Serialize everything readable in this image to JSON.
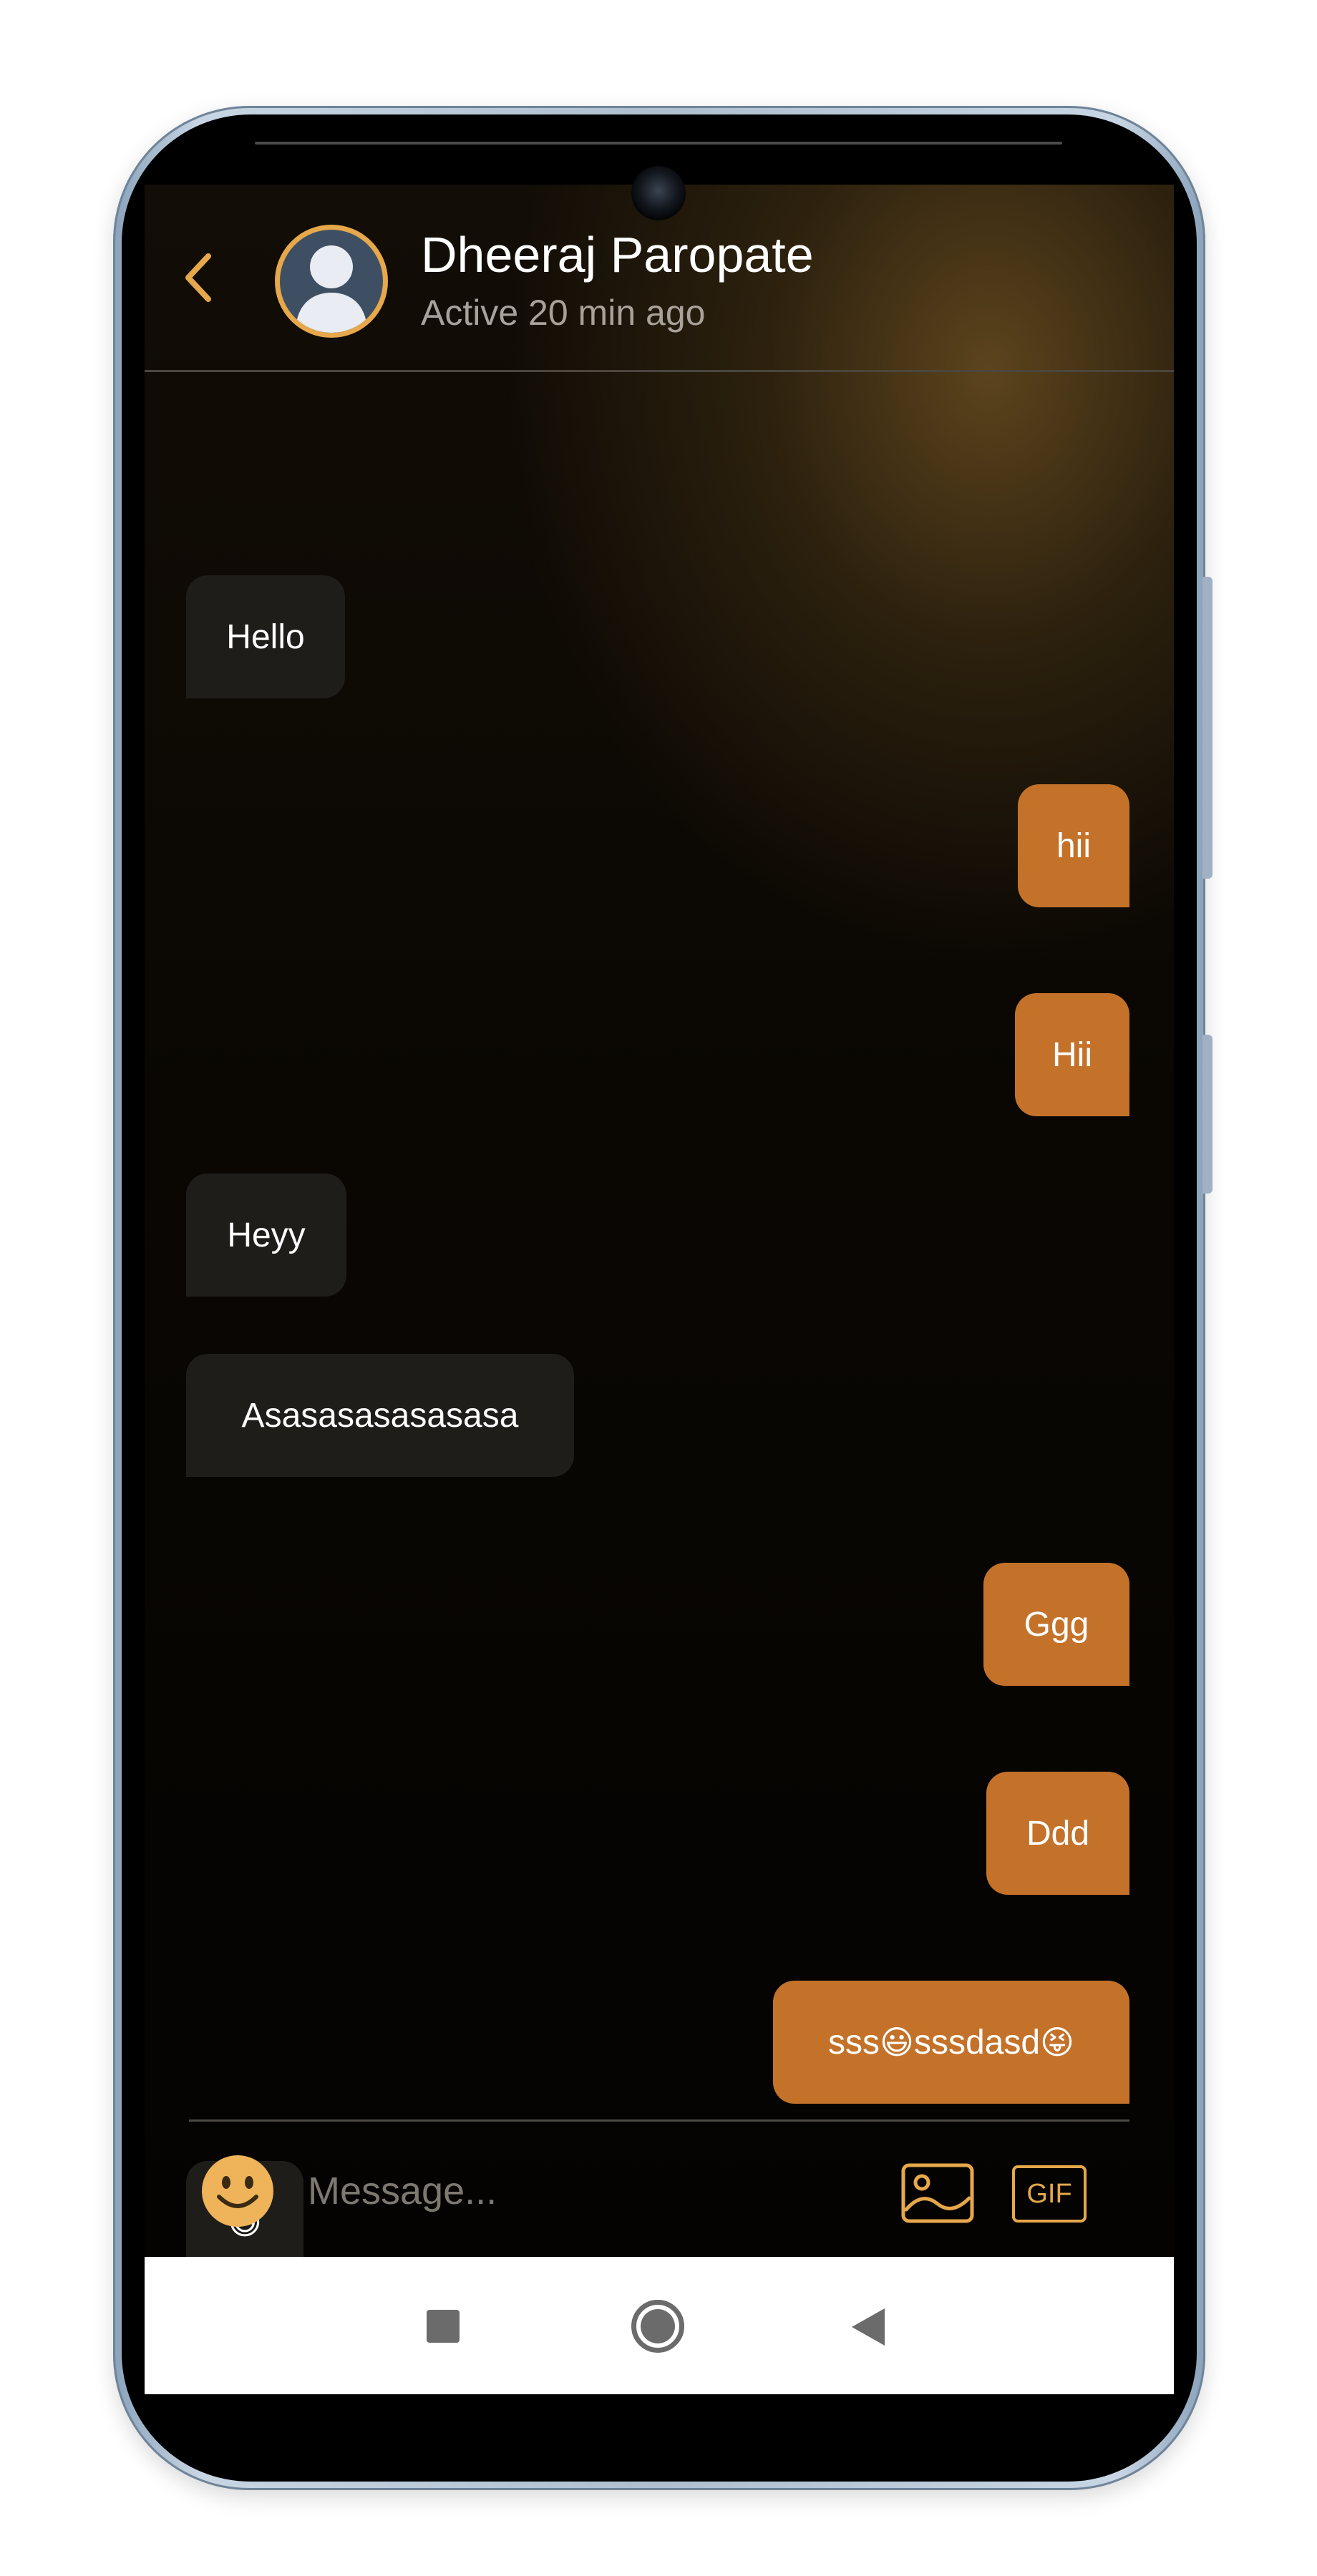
{
  "header": {
    "back_icon": "chevron-left-icon",
    "avatar_icon": "default-user-avatar",
    "contact_name": "Dheeraj Paropate",
    "status": "Active 20 min ago"
  },
  "messages": [
    {
      "direction": "in",
      "text": "Hello"
    },
    {
      "direction": "out",
      "text": "hii"
    },
    {
      "direction": "out",
      "text": "Hii"
    },
    {
      "direction": "in",
      "text": "Heyy"
    },
    {
      "direction": "in",
      "text": "Asasasasasasasa"
    },
    {
      "direction": "out",
      "text": "Ggg"
    },
    {
      "direction": "out",
      "text": "Ddd"
    },
    {
      "direction": "out",
      "text_before": "sss",
      "emoji_1": "😃",
      "text_middle": "sssdasd",
      "emoji_2": "😝"
    },
    {
      "direction": "in",
      "text": "😄"
    }
  ],
  "composer": {
    "emoji_icon": "smiley-face-icon",
    "placeholder": "Message...",
    "image_icon": "image-icon",
    "gif_label": "GIF"
  },
  "nav_bar": {
    "recents_icon": "square-icon",
    "home_icon": "circle-icon",
    "back_icon": "triangle-back-icon"
  },
  "colors": {
    "accent": "#e6a84b",
    "outgoing_bubble": "#c4722a",
    "incoming_bubble": "#1f1d1a",
    "background": "#0a0703"
  }
}
